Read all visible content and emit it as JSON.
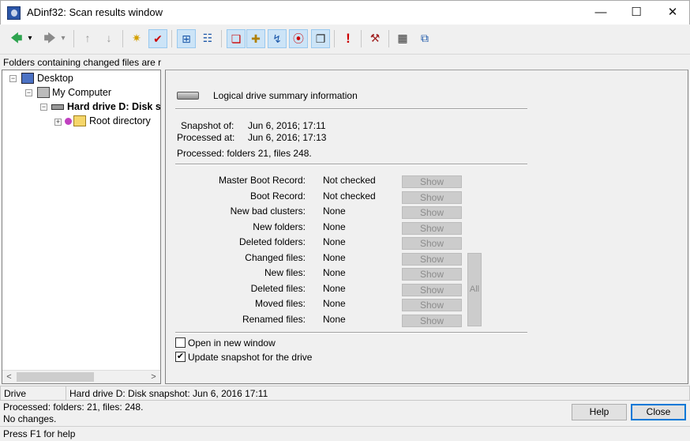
{
  "window": {
    "title": "ADinf32: Scan results window",
    "minimize": "—",
    "maximize": "☐",
    "close": "✕"
  },
  "toolbar": {
    "back": "🡄",
    "dropdown": "▾",
    "forward": "🡆",
    "up": "↑",
    "down": "↓",
    "star": "✷",
    "check": "✔",
    "inspect": "⊞",
    "tree": "☷",
    "n1": "❏",
    "n2": "✚",
    "n3": "↯",
    "n4": "⦿",
    "n5": "❐",
    "alert": "!",
    "tools": "⚒",
    "calendar": "▦",
    "network": "⧉",
    "colors": {
      "back": "#2ea44f",
      "forward": "#8a8a8a",
      "alert": "#cc0000"
    }
  },
  "hint": "Folders containing changed files are r",
  "tree": {
    "desktop": "Desktop",
    "computer": "My Computer",
    "drive": "Hard drive D: Disk sna",
    "root": "Root directory",
    "scroll_left": "<",
    "scroll_right": ">"
  },
  "summary": {
    "title": "Logical drive summary information",
    "snapshot_label": "Snapshot of:",
    "snapshot_value": "Jun 6, 2016;   17:11",
    "processed_label": "Processed at:",
    "processed_value": "Jun 6, 2016;   17:13",
    "processed_totals": "Processed:  folders 21,  files 248.",
    "rows": [
      {
        "label": "Master Boot Record:",
        "value": "Not checked",
        "button": "Show"
      },
      {
        "label": "Boot Record:",
        "value": "Not checked",
        "button": "Show"
      },
      {
        "label": "New bad clusters:",
        "value": "None",
        "button": "Show"
      },
      {
        "label": "New folders:",
        "value": "None",
        "button": "Show"
      },
      {
        "label": "Deleted folders:",
        "value": "None",
        "button": "Show"
      },
      {
        "label": "Changed files:",
        "value": "None",
        "button": "Show"
      },
      {
        "label": "New files:",
        "value": "None",
        "button": "Show"
      },
      {
        "label": "Deleted files:",
        "value": "None",
        "button": "Show"
      },
      {
        "label": "Moved files:",
        "value": "None",
        "button": "Show"
      },
      {
        "label": "Renamed files:",
        "value": "None",
        "button": "Show"
      }
    ],
    "all_button": "All",
    "open_new_window": "Open in new window",
    "open_new_window_checked": false,
    "update_snapshot": "Update snapshot for the drive",
    "update_snapshot_checked": true,
    "check_mark": "✔"
  },
  "status": {
    "drive_label": "Drive",
    "drive_value": "Hard drive D: Disk snapshot: Jun 6, 2016  17:11",
    "processed": "Processed: folders: 21, files: 248.",
    "changes": "No changes.",
    "help_hint": "Press F1 for help"
  },
  "buttons": {
    "help": "Help",
    "close": "Close"
  }
}
